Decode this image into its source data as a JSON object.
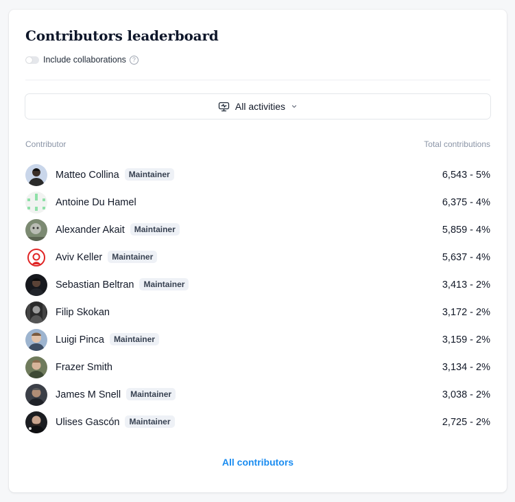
{
  "title": "Contributors leaderboard",
  "toggle": {
    "label": "Include collaborations",
    "on": false,
    "help": "?"
  },
  "dropdown": {
    "label": "All activities",
    "icon": "activity-icon"
  },
  "columns": {
    "contributor": "Contributor",
    "total": "Total contributions"
  },
  "badge_label": "Maintainer",
  "contributors": [
    {
      "name": "Matteo Collina",
      "maintainer": true,
      "stat": "6,543 - 5%"
    },
    {
      "name": "Antoine Du Hamel",
      "maintainer": false,
      "stat": "6,375 - 4%"
    },
    {
      "name": "Alexander Akait",
      "maintainer": true,
      "stat": "5,859 - 4%"
    },
    {
      "name": "Aviv Keller",
      "maintainer": true,
      "stat": "5,637 - 4%"
    },
    {
      "name": "Sebastian Beltran",
      "maintainer": true,
      "stat": "3,413 - 2%"
    },
    {
      "name": "Filip Skokan",
      "maintainer": false,
      "stat": "3,172 - 2%"
    },
    {
      "name": "Luigi Pinca",
      "maintainer": true,
      "stat": "3,159 - 2%"
    },
    {
      "name": "Frazer Smith",
      "maintainer": false,
      "stat": "3,134 - 2%"
    },
    {
      "name": "James M Snell",
      "maintainer": true,
      "stat": "3,038 - 2%"
    },
    {
      "name": "Ulises Gascón",
      "maintainer": true,
      "stat": "2,725 - 2%"
    }
  ],
  "all_link": "All contributors",
  "colors": {
    "accent": "#1a8cf0",
    "badge_bg": "#eef1f6",
    "muted": "#8a94a6"
  }
}
